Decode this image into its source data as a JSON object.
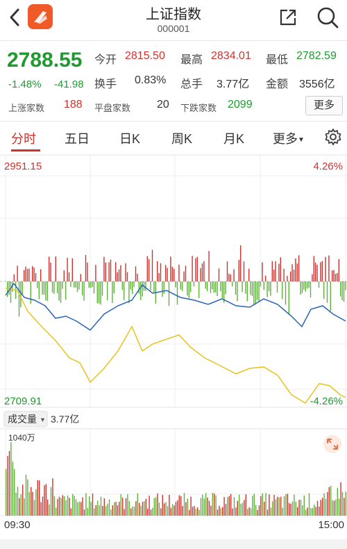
{
  "header": {
    "title": "上证指数",
    "code": "000001",
    "icons": [
      "back-icon",
      "app-logo-icon",
      "share-icon",
      "search-icon"
    ]
  },
  "quote": {
    "price": "2788.55",
    "change_pct": "-1.48%",
    "change": "-41.98",
    "open_label": "今开",
    "open": "2815.50",
    "high_label": "最高",
    "high": "2834.01",
    "low_label": "最低",
    "low": "2782.59",
    "turnover_label": "换手",
    "turnover": "0.83%",
    "volume_label": "总手",
    "volume": "3.77亿",
    "amount_label": "金额",
    "amount": "3556亿",
    "up_label": "上涨家数",
    "up_count": "188",
    "flat_label": "平盘家数",
    "flat_count": "20",
    "down_label": "下跌家数",
    "down_count": "2099",
    "more_button": "更多"
  },
  "tabs": [
    {
      "label": "分时"
    },
    {
      "label": "五日"
    },
    {
      "label": "日K"
    },
    {
      "label": "周K"
    },
    {
      "label": "月K"
    },
    {
      "label": "更多"
    }
  ],
  "chart": {
    "price_top": "2951.15",
    "price_bottom": "2709.91",
    "pct_top": "4.26%",
    "pct_bottom": "-4.26%",
    "volume_selector": "成交量",
    "volume_total": "3.77亿",
    "volume_max": "1040万",
    "time_start": "09:30",
    "time_end": "15:00",
    "colors": {
      "up": "#d0312d",
      "down": "#5cb338",
      "price_line": "#2a63b8",
      "avg_line": "#e8c21a"
    }
  }
}
